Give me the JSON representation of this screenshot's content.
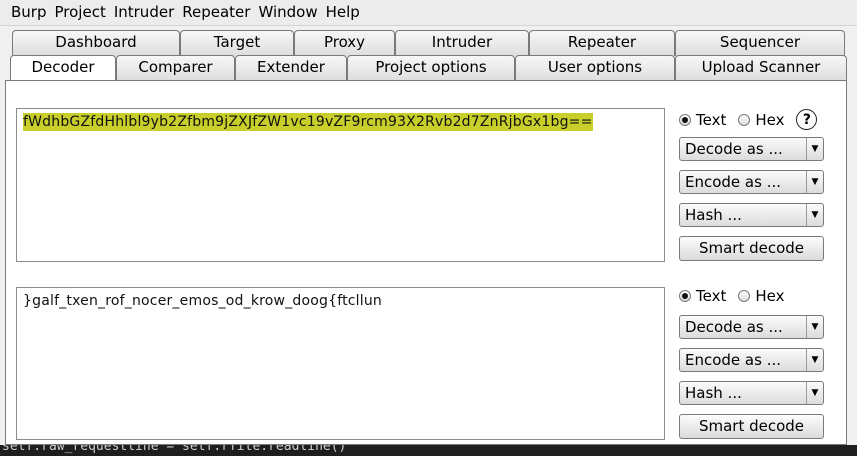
{
  "menubar": [
    "Burp",
    "Project",
    "Intruder",
    "Repeater",
    "Window",
    "Help"
  ],
  "tabs_back": [
    "Dashboard",
    "Target",
    "Proxy",
    "Intruder",
    "Repeater",
    "Sequencer"
  ],
  "tabs_front": [
    "Decoder",
    "Comparer",
    "Extender",
    "Project options",
    "User options",
    "Upload Scanner"
  ],
  "active_tab": "Decoder",
  "decoder": {
    "input_text": "fWdhbGZfdHhlbl9yb2Zfbm9jZXJfZW1vc19vZF9rcm93X2Rvb2d7ZnRjbGx1bg==",
    "output_text": "}galf_txen_rof_nocer_emos_od_krow_doog{ftcllun",
    "text_label": "Text",
    "hex_label": "Hex",
    "help_symbol": "?",
    "decode_label": "Decode as ...",
    "encode_label": "Encode as ...",
    "hash_label": "Hash ...",
    "smart_decode_label": "Smart decode"
  },
  "console_text": "self.raw_requestline = self.rfile.readline()",
  "colors": {
    "highlight": "#c8cf2a",
    "console_bg": "#1e1e1e"
  }
}
